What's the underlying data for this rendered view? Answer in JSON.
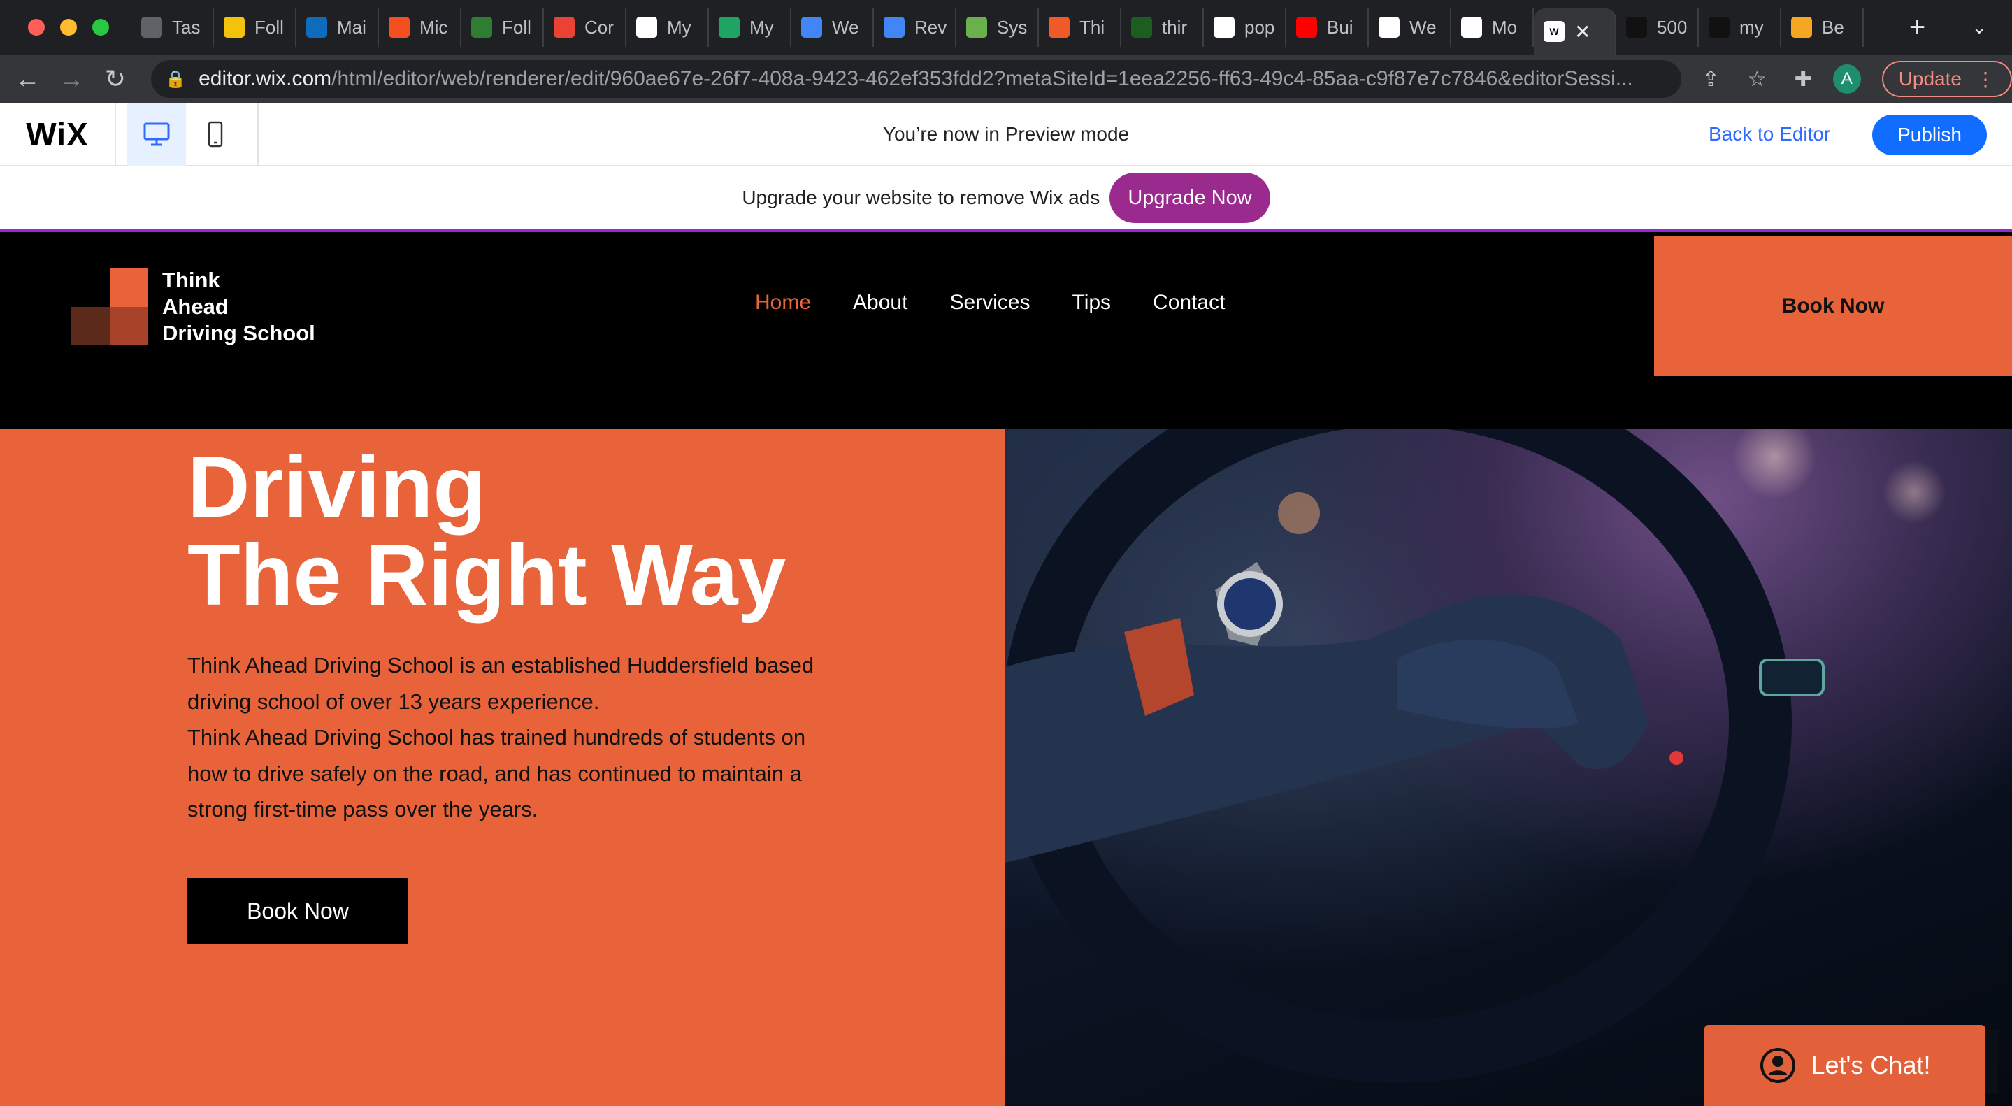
{
  "browser": {
    "tabs": [
      {
        "label": "Tas",
        "color": "#5f6368"
      },
      {
        "label": "Foll",
        "color": "#f4c20d"
      },
      {
        "label": "Mai",
        "color": "#0f6cbd"
      },
      {
        "label": "Mic",
        "color": "#f25022"
      },
      {
        "label": "Foll",
        "color": "#2e7d32"
      },
      {
        "label": "Cor",
        "color": "#ea4335"
      },
      {
        "label": "My",
        "color": "#ffffff"
      },
      {
        "label": "My",
        "color": "#1fa463"
      },
      {
        "label": "We",
        "color": "#4285f4"
      },
      {
        "label": "Rev",
        "color": "#4285f4"
      },
      {
        "label": "Sys",
        "color": "#6ab04c"
      },
      {
        "label": "Thi",
        "color": "#f05a28"
      },
      {
        "label": "thir",
        "color": "#1b5e20"
      },
      {
        "label": "pop",
        "color": "#ffffff"
      },
      {
        "label": "Bui",
        "color": "#ff0000"
      },
      {
        "label": "We",
        "color": "#ffffff"
      },
      {
        "label": "Mo",
        "color": "#ffffff"
      }
    ],
    "active_tab_icon": "wix-favicon-icon",
    "extra_tabs": [
      {
        "label": "500",
        "color": "#111111"
      },
      {
        "label": "my",
        "color": "#111111"
      },
      {
        "label": "Be",
        "color": "#f5a623"
      }
    ],
    "url_host": "editor.wix.com",
    "url_path": "/html/editor/web/renderer/edit/960ae67e-26f7-408a-9423-462ef353fdd2?metaSiteId=1eea2256-ff63-49c4-85aa-c9f87e7c7846&editorSessi...",
    "profile_initial": "A",
    "update_label": "Update"
  },
  "wix_bar": {
    "logo": "WiX",
    "preview_message": "You’re now in Preview mode",
    "back_label": "Back to Editor",
    "publish_label": "Publish"
  },
  "upgrade_banner": {
    "text": "Upgrade your website to remove Wix ads",
    "button": "Upgrade Now"
  },
  "site": {
    "logo_line1": "Think",
    "logo_line2": "Ahead",
    "logo_line3": "Driving School",
    "nav": [
      "Home",
      "About",
      "Services",
      "Tips",
      "Contact"
    ],
    "header_cta": "Book Now",
    "hero_title_1": "Driving",
    "hero_title_2": "The Right Way",
    "hero_body_1": "Think Ahead Driving School is an established Huddersfield based driving school of over 13 years experience.",
    "hero_body_2": "Think Ahead Driving School has trained hundreds of students on how to drive safely on the road, and has continued to maintain a strong first-time pass over the years.",
    "hero_cta": "Book Now",
    "chat_label": "Let's Chat!"
  },
  "colors": {
    "accent": "#e8633a",
    "black": "#000000",
    "wix_blue": "#116dff",
    "upgrade_purple": "#9a2a8e"
  }
}
